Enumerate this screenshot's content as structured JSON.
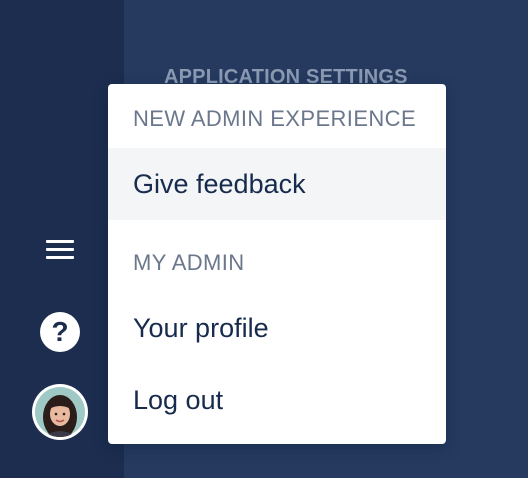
{
  "background": {
    "section_heading": "APPLICATION SETTINGS"
  },
  "nav": {
    "menu_icon": "hamburger-menu-icon",
    "help_icon": "question-mark-icon",
    "help_glyph": "?",
    "avatar_icon": "user-avatar"
  },
  "dropdown": {
    "groups": [
      {
        "heading": "NEW ADMIN EXPERIENCE",
        "items": [
          {
            "label": "Give feedback",
            "highlighted": true
          }
        ]
      },
      {
        "heading": "MY ADMIN",
        "items": [
          {
            "label": "Your profile",
            "highlighted": false
          },
          {
            "label": "Log out",
            "highlighted": false
          }
        ]
      }
    ]
  },
  "colors": {
    "rail": "#1c2d4f",
    "main": "#253a5e",
    "text": "#172b4d",
    "heading": "#6b778c",
    "highlight": "#f4f5f7"
  }
}
